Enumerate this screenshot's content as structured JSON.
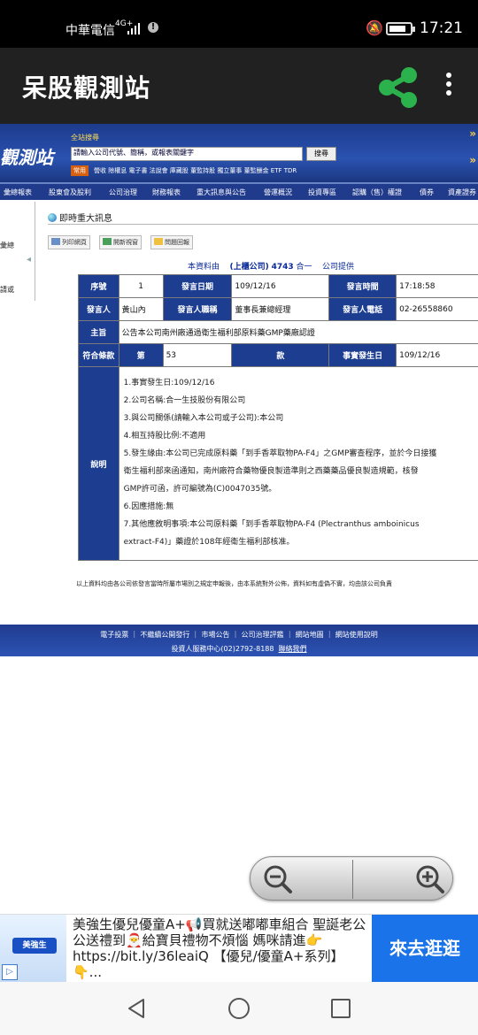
{
  "status_bar": {
    "carrier": "中華電信",
    "network": "4G+",
    "time": "17:21"
  },
  "app_bar": {
    "title": "呆股觀測站"
  },
  "site": {
    "logo": "觀測站",
    "search_label": "全站搜尋",
    "search_placeholder": "請輸入公司代號、簡稱，或報表關鍵字",
    "search_button": "搜尋",
    "common_tag": "常用",
    "quick_links": "營收 除權息 電子書 法說會 庫藏股 董監持股 獨立董事 董監酬金 ETF TDR",
    "nav": [
      "彙總報表",
      "股東會及股利",
      "公司治理",
      "財務報表",
      "重大訊息與公告",
      "營運概況",
      "投資專區",
      "認購（售）權證",
      "債券",
      "資產證券"
    ],
    "sidebar": [
      "彙總",
      "請或"
    ]
  },
  "page": {
    "title": "即時重大訊息",
    "buttons": {
      "print": "列印網頁",
      "new_window": "開新視窗",
      "feedback": "問題回報"
    },
    "source": {
      "prefix": "本資料由",
      "market": "(上櫃公司)",
      "code": "4743",
      "company": "合一",
      "suffix": "公司提供"
    }
  },
  "table": {
    "seq_label": "序號",
    "seq_value": "1",
    "date_label": "發言日期",
    "date_value": "109/12/16",
    "time_label": "發言時間",
    "time_value": "17:18:58",
    "speaker_label": "發言人",
    "speaker_value": "黃山內",
    "title_label": "發言人職稱",
    "title_value": "董事長兼總經理",
    "phone_label": "發言人電話",
    "phone_value": "02-26558860",
    "subject_label": "主旨",
    "subject_value": "公告本公司南州廠通過衛生福利部原料藥GMP藥廠認證",
    "clause_label": "符合條款",
    "clause_prefix": "第",
    "clause_no": "53",
    "clause_suffix": "款",
    "event_date_label": "事實發生日",
    "event_date_value": "109/12/16",
    "desc_label": "說明",
    "desc_lines": [
      "1.事實發生日:109/12/16",
      "2.公司名稱:合一生技股份有限公司",
      "3.與公司關係(請輸入本公司或子公司):本公司",
      "4.相互持股比例:不適用",
      "5.發生緣由:本公司已完成原料藥「到手香萃取物PA-F4」之GMP審查程序，並於今日接獲",
      "衛生福利部來函通知，南州廠符合藥物優良製造準則之西藥藥品優良製造規範，核發",
      "GMP許可函，許可編號為(C)0047035號。",
      "6.因應措施:無",
      "7.其他應敘明事項:本公司原料藥「到手香萃取物PA-F4 (Plectranthus amboinicus",
      "extract-F4)」藥證於108年經衛生福利部核准。"
    ]
  },
  "disclaimer": "以上資料均由各公司依發言當時所屬市場別之規定申報後，由本系統對外公佈，資料如有虛偽不實，均由該公司負責",
  "footer": {
    "links": "電子投票 ｜ 不繼續公開發行 ｜ 市場公告 ｜ 公司治理評鑑 ｜ 網站地圖 ｜ 網站使用說明",
    "service_prefix": "投資人服務中心(02)2792-8188",
    "contact": "聯絡我們"
  },
  "ad": {
    "brand": "美強生",
    "text": "美強生優兒優童A+📢買就送嘟嘟車組合 聖誕老公公送禮到🎅給寶貝禮物不煩惱 媽咪請進👉https://bit.ly/36leaiQ 【優兒/優童A+系列】👇...",
    "cta": "來去逛逛"
  },
  "colors": {
    "accent_green": "#2bb24c",
    "header_blue": "#1d3d91",
    "cta_blue": "#1a73e8"
  }
}
